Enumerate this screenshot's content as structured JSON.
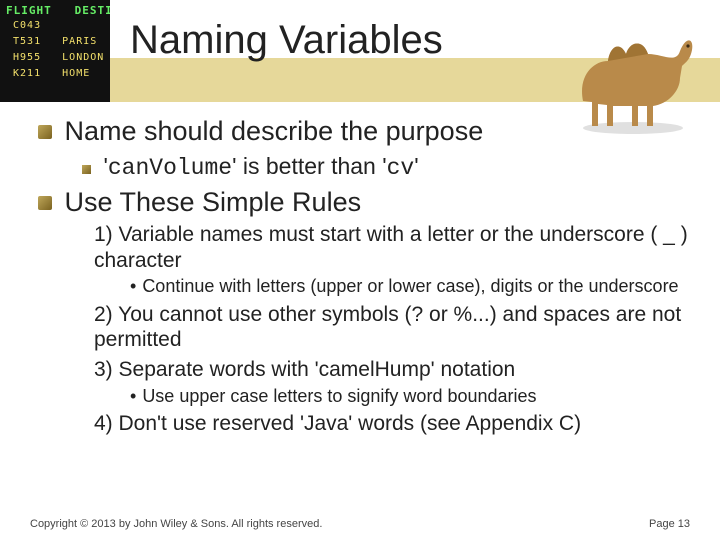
{
  "title": "Naming Variables",
  "topBullets": {
    "a": "Name should describe the purpose",
    "aSub_pre": "'",
    "aSub_code1": "canVolume",
    "aSub_mid": "' is better than '",
    "aSub_code2": "cv",
    "aSub_post": "'",
    "b": "Use These Simple Rules"
  },
  "rules": {
    "r1": "1) Variable names must start with a letter or the underscore ( _ ) character",
    "r1a": "Continue with letters (upper or lower case), digits or the underscore",
    "r2": "2) You cannot use other symbols (? or %...) and spaces are not permitted",
    "r3": "3) Separate words with 'camelHump' notation",
    "r3a": "Use upper case letters to signify word boundaries",
    "r4": "4) Don't use reserved 'Java' words (see Appendix C)"
  },
  "footer": {
    "copyright": "Copyright © 2013 by John Wiley & Sons. All rights reserved.",
    "page": "Page 13"
  },
  "decor": {
    "board": {
      "hdr": "FLIGHT   DESTINA",
      "l1": " C043   ",
      "l2": " T531   PARIS",
      "l3": " H955   LONDON",
      "l4": " K211   HOME"
    }
  }
}
